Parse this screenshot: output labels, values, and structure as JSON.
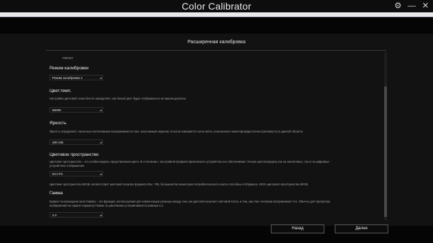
{
  "app": {
    "title": "Color Calibrator"
  },
  "window_controls": {
    "settings_glyph": "⚙",
    "minimize_glyph": "—",
    "close_glyph": "✕"
  },
  "panel": {
    "title": "Расширенная калибровка",
    "preset_label": "PRESET"
  },
  "sections": {
    "mode": {
      "title": "Режим калибровки",
      "value": "Режим калибровки 2"
    },
    "temp": {
      "title": "Цвет.темп.",
      "description": "Настройка цветовой точки белого определяет, как белый цвет будет отображаться на вашем дисплее.",
      "value": "6500K"
    },
    "brightness": {
      "title": "Яркость",
      "description": "Яркость определяет, насколько интенсивным воспринимается свет, излучаемый экраном. В нитах измеряется сила света, излучаемого монитором/дисплеем (светимость) в данной области.",
      "value": "250 nits"
    },
    "colorspace": {
      "title": "Цветовое пространство",
      "description": "Цветовое пространство – это особая модель представления цвета. В сочетании с настройкой профиля физического устройства оно обеспечивает точную цветопередачу как на аналоговых, так и на цифровых устройствах отображения.",
      "value": "DCI-P3",
      "note": "Цветовое пространство sRGB соответствует цветовой палитре формата Rec. 709, большинство мониторов потребительского класса способны отображать 100% цветового пространства sRGB."
    },
    "gamma": {
      "title": "Гамма",
      "description": "Кривая тонопередачи (или Гамма) – это функция, используемая для компенсации разницы между тем, как дисплей излучает световой поток, и тем, как глаз человека воспринимает его. Обычно для просмотра изображений на экране параметр Гамма по умолчанию устанавливается равным 2.2.",
      "value": "2.2"
    }
  },
  "buttons": {
    "back": "Назад",
    "next": "Далее"
  },
  "colors": {
    "background": "#111111",
    "band": "#050505",
    "strip": "#e9e9ec"
  }
}
